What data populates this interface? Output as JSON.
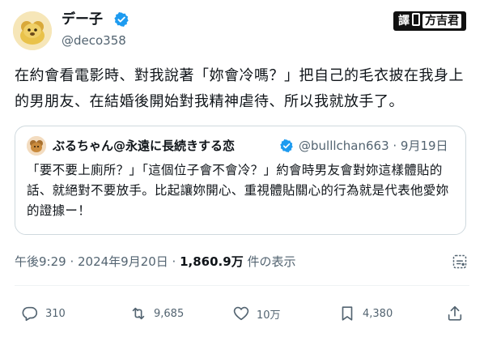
{
  "author": {
    "display_name": "デー子",
    "handle": "@deco358",
    "avatar_icon": "dog-avatar-icon",
    "verified_icon": "verified-badge-icon"
  },
  "watermark": {
    "left": "譯",
    "right": "方吉君"
  },
  "tweet": {
    "text": "在約會看電影時、對我說著「妳會冷嗎？」把自己的毛衣披在我身上的男朋友、在結婚後開始對我精神虐待、所以我就放手了。"
  },
  "quoted": {
    "display_name": "ぶるちゃん@永遠に長続きする恋",
    "handle_date": "@bulllchan663 · 9月19日",
    "text": "「要不要上廁所？」「這個位子會不會冷？」約會時男友會對妳這樣體貼的話、就絕對不要放手。比起讓妳開心、重視體貼關心的行為就是代表他愛妳的證據ー！",
    "avatar_icon": "dog-avatar-icon"
  },
  "meta": {
    "datetime": "午後9:29 · 2024年9月20日 · ",
    "views_count": "1,860.9万",
    "views_label": " 件の表示"
  },
  "actions": {
    "replies": "310",
    "reposts": "9,685",
    "likes": "10万",
    "bookmarks": "4,380"
  },
  "colors": {
    "verified": "#1d9bf0",
    "secondary_text": "#536471",
    "border": "#cfd9de"
  }
}
